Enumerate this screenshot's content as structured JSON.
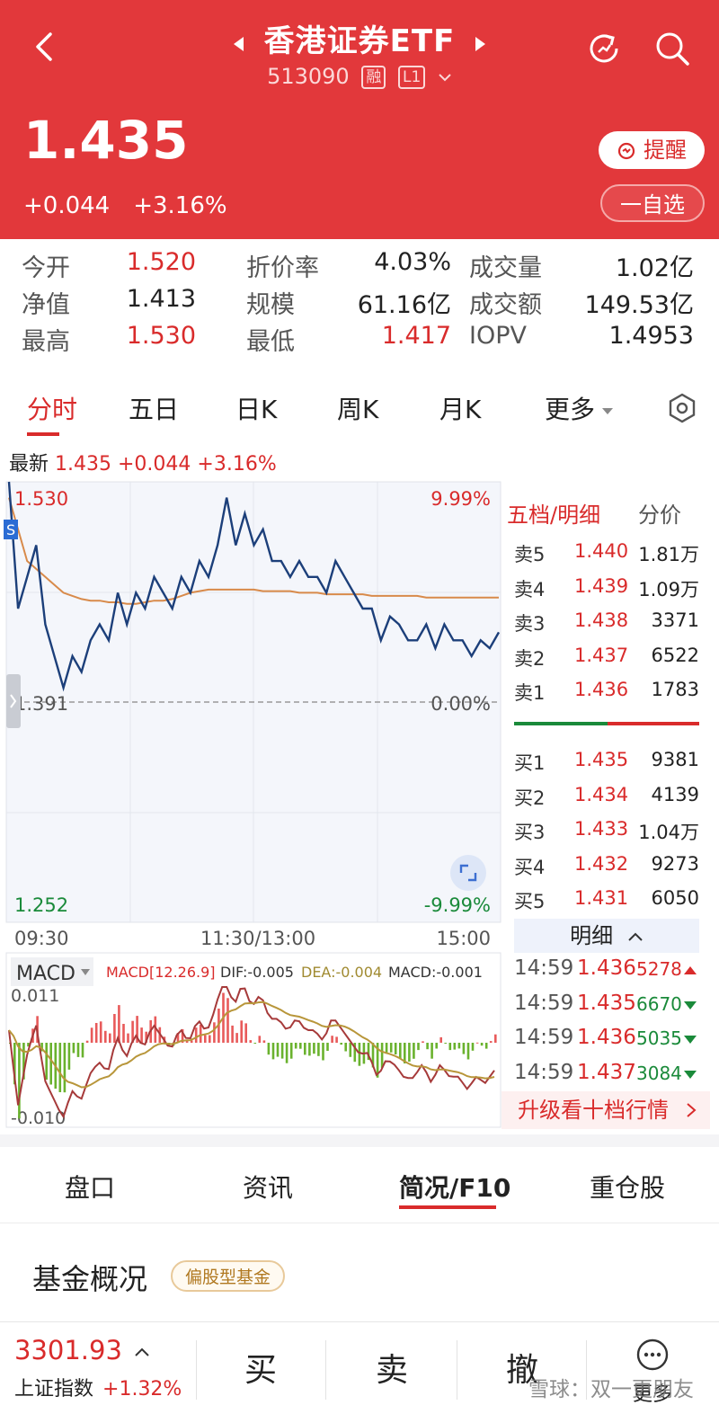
{
  "header": {
    "title": "香港证券ETF",
    "code": "513090",
    "tag_margin": "融",
    "tag_level": "L1",
    "price": "1.435",
    "change": "+0.044",
    "change_pct": "+3.16%",
    "remind_label": "提醒",
    "watch_label": "一自选"
  },
  "stats": [
    [
      {
        "k": "今开",
        "v": "1.520",
        "c": "red"
      },
      {
        "k": "折价率",
        "v": "4.03%",
        "c": "dark"
      },
      {
        "k": "成交量",
        "v": "1.02亿",
        "c": "dark"
      }
    ],
    [
      {
        "k": "净值",
        "v": "1.413",
        "c": "dark"
      },
      {
        "k": "规模",
        "v": "61.16亿",
        "c": "dark"
      },
      {
        "k": "成交额",
        "v": "149.53亿",
        "c": "dark"
      }
    ],
    [
      {
        "k": "最高",
        "v": "1.530",
        "c": "red"
      },
      {
        "k": "最低",
        "v": "1.417",
        "c": "red"
      },
      {
        "k": "IOPV",
        "v": "1.4953",
        "c": "dark"
      }
    ]
  ],
  "tabs": [
    "分时",
    "五日",
    "日K",
    "周K",
    "月K",
    "更多"
  ],
  "latest": {
    "label": "最新",
    "price": "1.435",
    "change": "+0.044",
    "pct": "+3.16%"
  },
  "chart": {
    "y_top": "1.530",
    "y_mid": "1.391",
    "y_bot": "1.252",
    "pct_top": "9.99%",
    "pct_mid": "0.00%",
    "pct_bot": "-9.99%",
    "x_start": "09:30",
    "x_mid": "11:30/13:00",
    "x_end": "15:00",
    "macd_label": "MACD",
    "macd_params": "MACD[12.26.9]",
    "dif": "DIF:-0.005",
    "dea": "DEA:-0.004",
    "macd_val": "MACD:-0.001",
    "macd_top": "0.011",
    "macd_bot": "-0.010"
  },
  "chart_data": {
    "type": "line",
    "ylim": [
      1.252,
      1.53
    ],
    "series": [
      {
        "values": [
          1.53,
          1.45,
          1.47,
          1.49,
          1.44,
          1.42,
          1.4,
          1.42,
          1.41,
          1.43,
          1.44,
          1.43,
          1.46,
          1.44,
          1.46,
          1.45,
          1.47,
          1.46,
          1.45,
          1.47,
          1.46,
          1.48,
          1.47,
          1.49,
          1.52,
          1.49,
          1.51,
          1.49,
          1.5,
          1.48,
          1.48,
          1.47,
          1.48,
          1.47,
          1.47,
          1.46,
          1.48,
          1.47,
          1.46,
          1.45,
          1.45,
          1.43,
          1.445,
          1.44,
          1.43,
          1.43,
          1.44,
          1.425,
          1.44,
          1.43,
          1.43,
          1.42,
          1.43,
          1.425,
          1.435
        ]
      },
      {
        "values": [
          1.52,
          1.5,
          1.48,
          1.475,
          1.47,
          1.465,
          1.46,
          1.458,
          1.456,
          1.455,
          1.455,
          1.454,
          1.454,
          1.453,
          1.453,
          1.454,
          1.455,
          1.455,
          1.456,
          1.458,
          1.46,
          1.461,
          1.462,
          1.462,
          1.462,
          1.462,
          1.462,
          1.462,
          1.461,
          1.461,
          1.461,
          1.461,
          1.46,
          1.46,
          1.46,
          1.459,
          1.459,
          1.459,
          1.459,
          1.459,
          1.458,
          1.458,
          1.458,
          1.458,
          1.458,
          1.458,
          1.457,
          1.457,
          1.457,
          1.457,
          1.457,
          1.457,
          1.457,
          1.457,
          1.457
        ]
      }
    ]
  },
  "orderbook": {
    "title": "五档/明细",
    "split": "分价",
    "sells": [
      {
        "l": "卖5",
        "p": "1.440",
        "v": "1.81万"
      },
      {
        "l": "卖4",
        "p": "1.439",
        "v": "1.09万"
      },
      {
        "l": "卖3",
        "p": "1.438",
        "v": "3371"
      },
      {
        "l": "卖2",
        "p": "1.437",
        "v": "6522"
      },
      {
        "l": "卖1",
        "p": "1.436",
        "v": "1783"
      }
    ],
    "buys": [
      {
        "l": "买1",
        "p": "1.435",
        "v": "9381"
      },
      {
        "l": "买2",
        "p": "1.434",
        "v": "4139"
      },
      {
        "l": "买3",
        "p": "1.433",
        "v": "1.04万"
      },
      {
        "l": "买4",
        "p": "1.432",
        "v": "9273"
      },
      {
        "l": "买5",
        "p": "1.431",
        "v": "6050"
      }
    ],
    "detail_label": "明细",
    "trades": [
      {
        "t": "14:59",
        "p": "1.436",
        "v": "5278",
        "dir": "up"
      },
      {
        "t": "14:59",
        "p": "1.435",
        "v": "6670",
        "dir": "down"
      },
      {
        "t": "14:59",
        "p": "1.436",
        "v": "5035",
        "dir": "down"
      },
      {
        "t": "14:59",
        "p": "1.437",
        "v": "3084",
        "dir": "down"
      }
    ],
    "upgrade": "升级看十档行情"
  },
  "sections": [
    "盘口",
    "资讯",
    "简况/F10",
    "重仓股"
  ],
  "fund": {
    "title": "基金概况",
    "tag": "偏股型基金"
  },
  "bottom": {
    "index_value": "3301.93",
    "index_name": "上证指数",
    "index_pct": "+1.32%",
    "buy": "买",
    "sell": "卖",
    "cancel": "撤",
    "more": "更多"
  },
  "watermark": "雪球：双一更朋友",
  "colors": {
    "brand": "#e2383b",
    "up": "#d92b2b",
    "down": "#1a8a3a",
    "price_line": "#1c3f7a",
    "avg_line": "#d88a4a"
  }
}
